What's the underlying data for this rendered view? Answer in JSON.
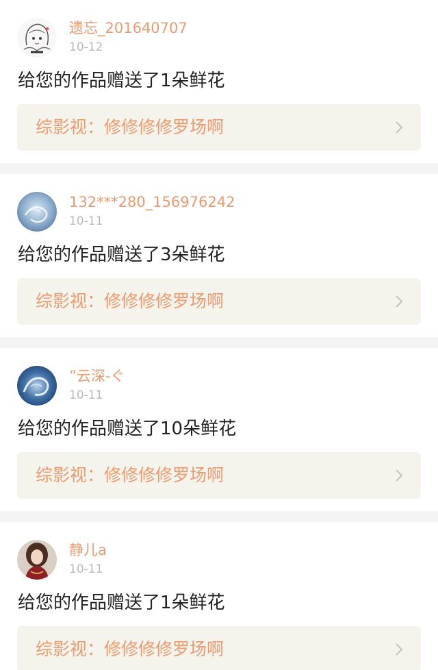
{
  "notifications": [
    {
      "username": "遗忘_201640707",
      "date": "10-12",
      "message": "给您的作品赠送了1朵鲜花",
      "work_title": "综影视：修修修修罗场啊",
      "avatar": "anime-girl-sketch-avatar"
    },
    {
      "username": "132***280_156976242",
      "date": "10-11",
      "message": "给您的作品赠送了3朵鲜花",
      "work_title": "综影视：修修修修罗场啊",
      "avatar": "blue-abstract-avatar"
    },
    {
      "username": "”云深-ぐ",
      "date": "10-11",
      "message": "给您的作品赠送了10朵鲜花",
      "work_title": "综影视：修修修修罗场啊",
      "avatar": "blue-dragon-avatar"
    },
    {
      "username": "静儿a",
      "date": "10-11",
      "message": "给您的作品赠送了1朵鲜花",
      "work_title": "综影视：修修修修罗场啊",
      "avatar": "woman-portrait-avatar"
    }
  ],
  "colors": {
    "username": "#ef9a6e",
    "date": "#b8b8b8",
    "message": "#222222",
    "link_background": "#f4f4ed",
    "separator": "#f4f4f4"
  }
}
